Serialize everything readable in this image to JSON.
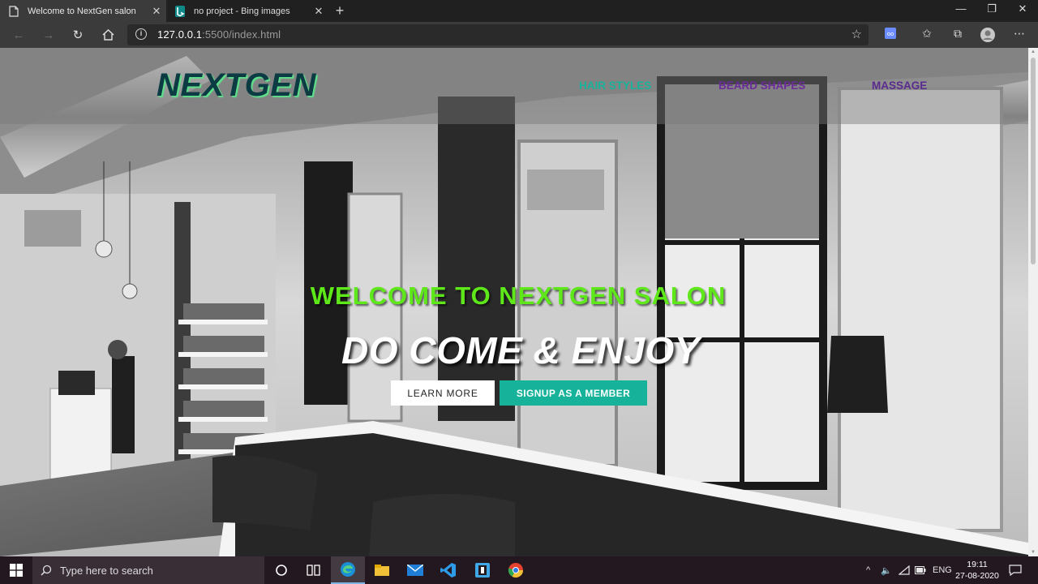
{
  "browser": {
    "tabs": [
      {
        "title": "Welcome to NextGen salon",
        "active": true,
        "favicon": "page-icon"
      },
      {
        "title": "no project - Bing images",
        "active": false,
        "favicon": "bing-icon"
      }
    ],
    "url_host": "127.0.0.1",
    "url_rest": ":5500/index.html"
  },
  "site": {
    "logo": "NEXTGEN",
    "nav": [
      "HAIR STYLES",
      "BEARD SHAPES",
      "MASSAGE"
    ],
    "welcome": "WELCOME TO NEXTGEN SALON",
    "tagline": "DO COME & ENJOY",
    "buttons": {
      "learn_more": "LEARN MORE",
      "signup": "SIGNUP AS A MEMBER"
    },
    "colors": {
      "teal": "#16b39a",
      "purple": "#6b2b9a",
      "green": "#5ee81a",
      "logo": "#0d3b44"
    }
  },
  "taskbar": {
    "search_placeholder": "Type here to search",
    "lang": "ENG",
    "time": "19:11",
    "date": "27-08-2020",
    "apps": [
      "task-view-icon",
      "edge-icon",
      "file-explorer-icon",
      "mail-icon",
      "vscode-icon",
      "app-icon",
      "chrome-icon"
    ]
  }
}
